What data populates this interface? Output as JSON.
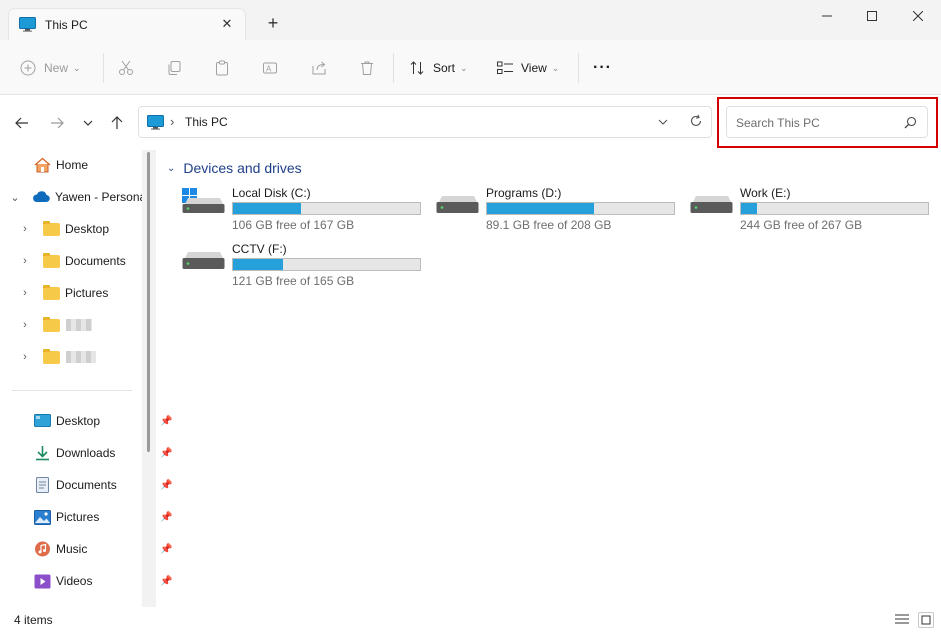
{
  "window": {
    "tab_title": "This PC",
    "new_tab_label": "+",
    "tab_close_label": "✕"
  },
  "toolbar": {
    "new_label": "New",
    "sort_label": "Sort",
    "view_label": "View",
    "more_label": "···"
  },
  "address": {
    "path": "This PC",
    "separator": "›"
  },
  "search": {
    "placeholder": "Search This PC"
  },
  "sidebar": {
    "home": "Home",
    "onedrive": "Yawen - Personal",
    "tree": [
      "Desktop",
      "Documents",
      "Pictures"
    ],
    "quick_access": [
      {
        "label": "Desktop",
        "icon": "desktop-icon"
      },
      {
        "label": "Downloads",
        "icon": "download-icon"
      },
      {
        "label": "Documents",
        "icon": "document-icon"
      },
      {
        "label": "Pictures",
        "icon": "picture-icon"
      },
      {
        "label": "Music",
        "icon": "music-icon"
      },
      {
        "label": "Videos",
        "icon": "video-icon"
      }
    ]
  },
  "main": {
    "group_title": "Devices and drives",
    "drives": [
      {
        "name": "Local Disk (C:)",
        "free_text": "106 GB free of 167 GB",
        "used_fraction": 0.365
      },
      {
        "name": "Programs (D:)",
        "free_text": "89.1 GB free of 208 GB",
        "used_fraction": 0.572
      },
      {
        "name": "Work (E:)",
        "free_text": "244 GB free of 267 GB",
        "used_fraction": 0.086
      },
      {
        "name": "CCTV (F:)",
        "free_text": "121 GB free of 165 GB",
        "used_fraction": 0.267
      }
    ]
  },
  "status": {
    "items_count": "4 items"
  },
  "colors": {
    "accent": "#26a0da",
    "highlight_frame": "#d40000",
    "group_header": "#1f3f8a"
  }
}
